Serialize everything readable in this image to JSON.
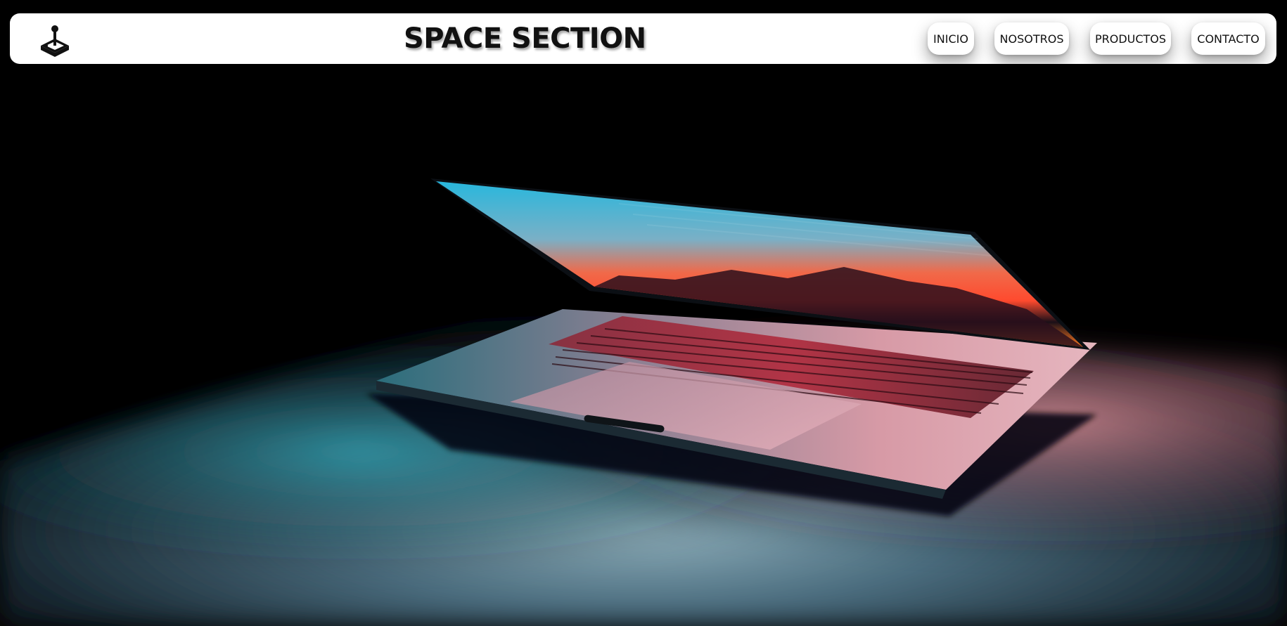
{
  "header": {
    "logo_icon": "joystick-icon",
    "brand": "SPACE SECTION",
    "nav": [
      {
        "label": "INICIO"
      },
      {
        "label": "NOSOTROS"
      },
      {
        "label": "PRODUCTOS"
      },
      {
        "label": "CONTACTO"
      }
    ]
  },
  "hero": {
    "image": "half-open-laptop-glowing-in-dark-room",
    "colors": {
      "background": "#000000",
      "screen_sky": "#2bb3d6",
      "screen_sunset": "#ff5a3a",
      "keyboard_glow": "#e0324a",
      "desk_light": "#6f8fa0"
    }
  }
}
